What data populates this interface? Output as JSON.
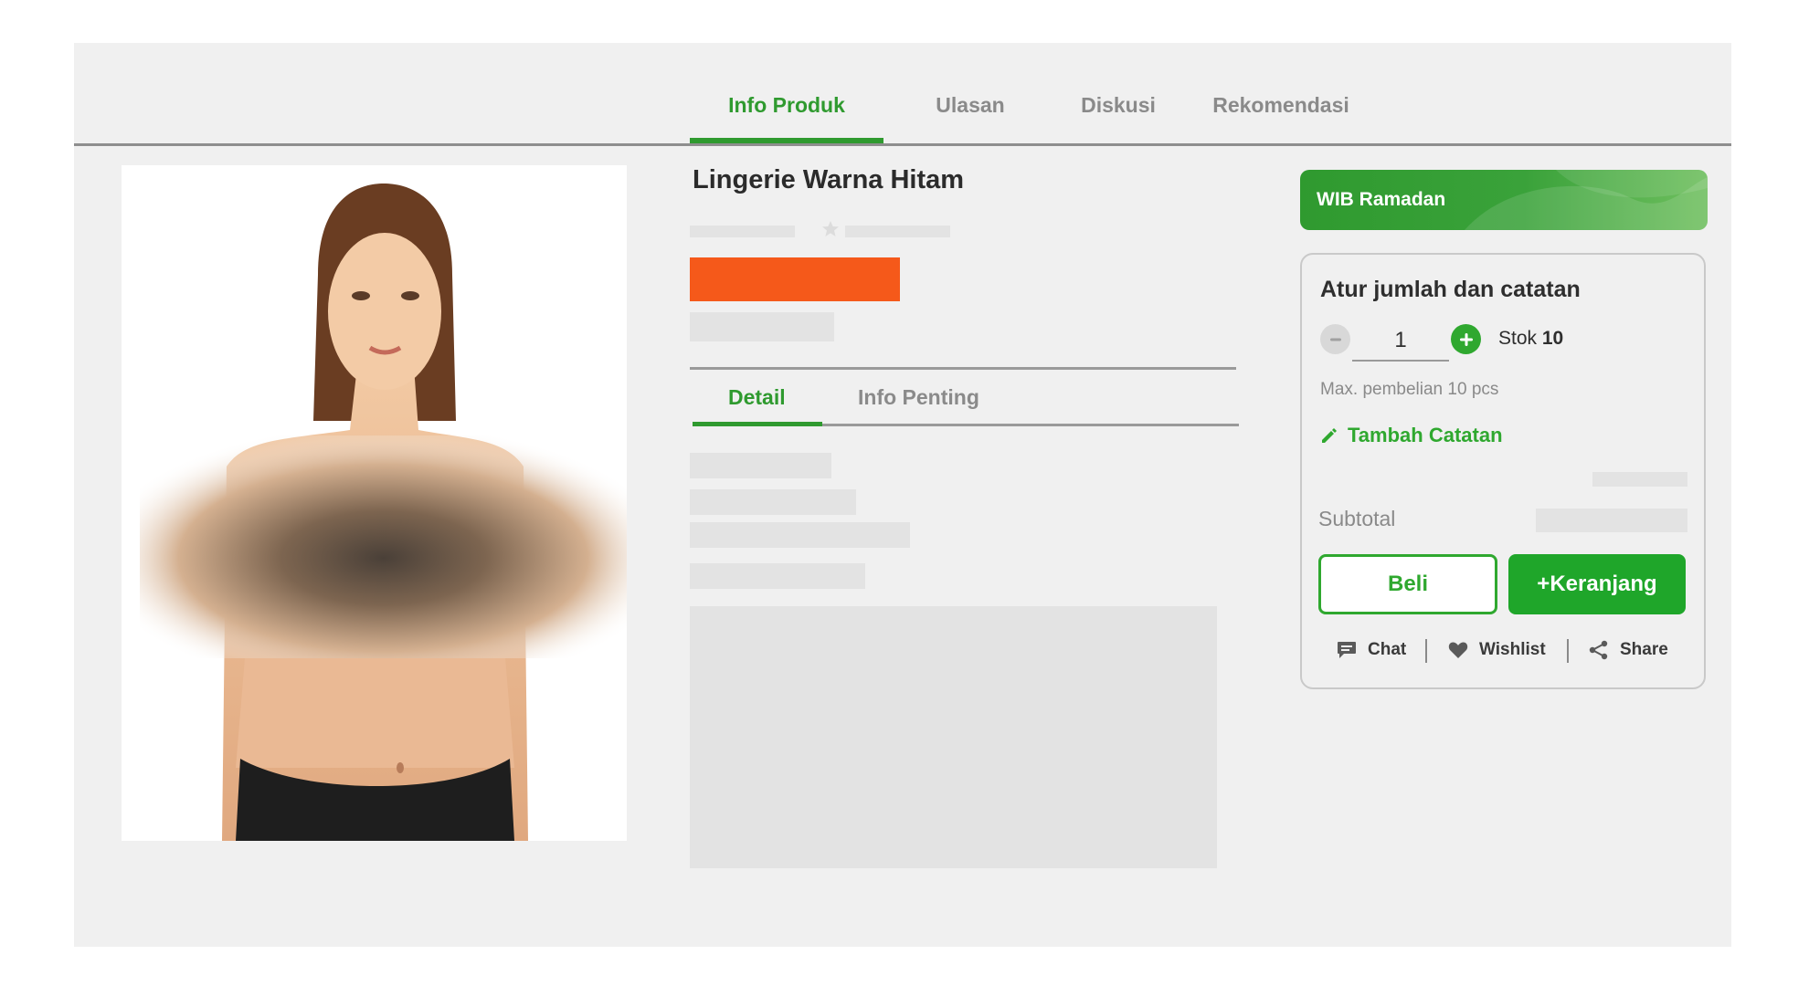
{
  "tabs": [
    {
      "label": "Info Produk",
      "active": true
    },
    {
      "label": "Ulasan",
      "active": false
    },
    {
      "label": "Diskusi",
      "active": false
    },
    {
      "label": "Rekomendasi",
      "active": false
    }
  ],
  "product": {
    "title": "Lingerie Warna Hitam",
    "image_alt": "product-photo"
  },
  "subtabs": [
    {
      "label": "Detail",
      "active": true
    },
    {
      "label": "Info Penting",
      "active": false
    }
  ],
  "promo": {
    "label": "WIB Ramadan"
  },
  "purchase": {
    "title": "Atur jumlah dan catatan",
    "quantity": "1",
    "stock_label": "Stok",
    "stock_value": "10",
    "max_note": "Max. pembelian 10 pcs",
    "add_note": "Tambah Catatan",
    "subtotal_label": "Subtotal",
    "buy_label": "Beli",
    "cart_label": "+Keranjang",
    "actions": [
      {
        "label": "Chat",
        "icon": "chat-icon"
      },
      {
        "label": "Wishlist",
        "icon": "heart-icon"
      },
      {
        "label": "Share",
        "icon": "share-icon"
      }
    ]
  },
  "colors": {
    "accent": "#2f9a2f",
    "price": "#f5591a",
    "skeleton": "#e3e3e3",
    "background": "#f0f0f0"
  }
}
